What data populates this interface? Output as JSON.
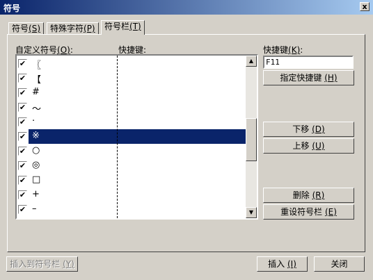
{
  "window": {
    "title": "符号",
    "close_label": "x"
  },
  "tabs": [
    {
      "label": "符号",
      "key": "(S)"
    },
    {
      "label": "特殊字符",
      "key": "(P)"
    },
    {
      "label": "符号栏",
      "key": "(T)"
    }
  ],
  "list": {
    "header_symbol": "自定义符号",
    "header_symbol_key": "(O)",
    "header_symbol_suffix": ":",
    "header_shortcut": "快捷键:",
    "items": [
      {
        "symbol": "〖",
        "checked": true
      },
      {
        "symbol": "【",
        "checked": true
      },
      {
        "symbol": "#",
        "checked": true
      },
      {
        "symbol": "〜",
        "checked": true
      },
      {
        "symbol": "·",
        "checked": true
      },
      {
        "symbol": "※",
        "checked": true,
        "selected": true
      },
      {
        "symbol": "○",
        "checked": true
      },
      {
        "symbol": "◎",
        "checked": true
      },
      {
        "symbol": "□",
        "checked": true
      },
      {
        "symbol": "+",
        "checked": true
      },
      {
        "symbol": "–",
        "checked": true
      }
    ],
    "check_mark": "✔"
  },
  "shortcut": {
    "label": "快捷键",
    "label_key": "(K)",
    "label_suffix": ":",
    "value": "F11",
    "assign_label": "指定快捷键",
    "assign_key": "(H)"
  },
  "buttons": {
    "move_down": {
      "label": "下移",
      "key": "(D)"
    },
    "move_up": {
      "label": "上移",
      "key": "(U)"
    },
    "delete": {
      "label": "删除",
      "key": "(R)"
    },
    "reset": {
      "label": "重设符号栏",
      "key": "(E)"
    },
    "insert_to_bar": {
      "label": "插入到符号栏",
      "key": "(Y)"
    },
    "insert": {
      "label": "插入",
      "key": "(I)"
    },
    "close": {
      "label": "关闭"
    }
  },
  "scrollbar": {
    "up_arrow": "▲",
    "down_arrow": "▼"
  }
}
